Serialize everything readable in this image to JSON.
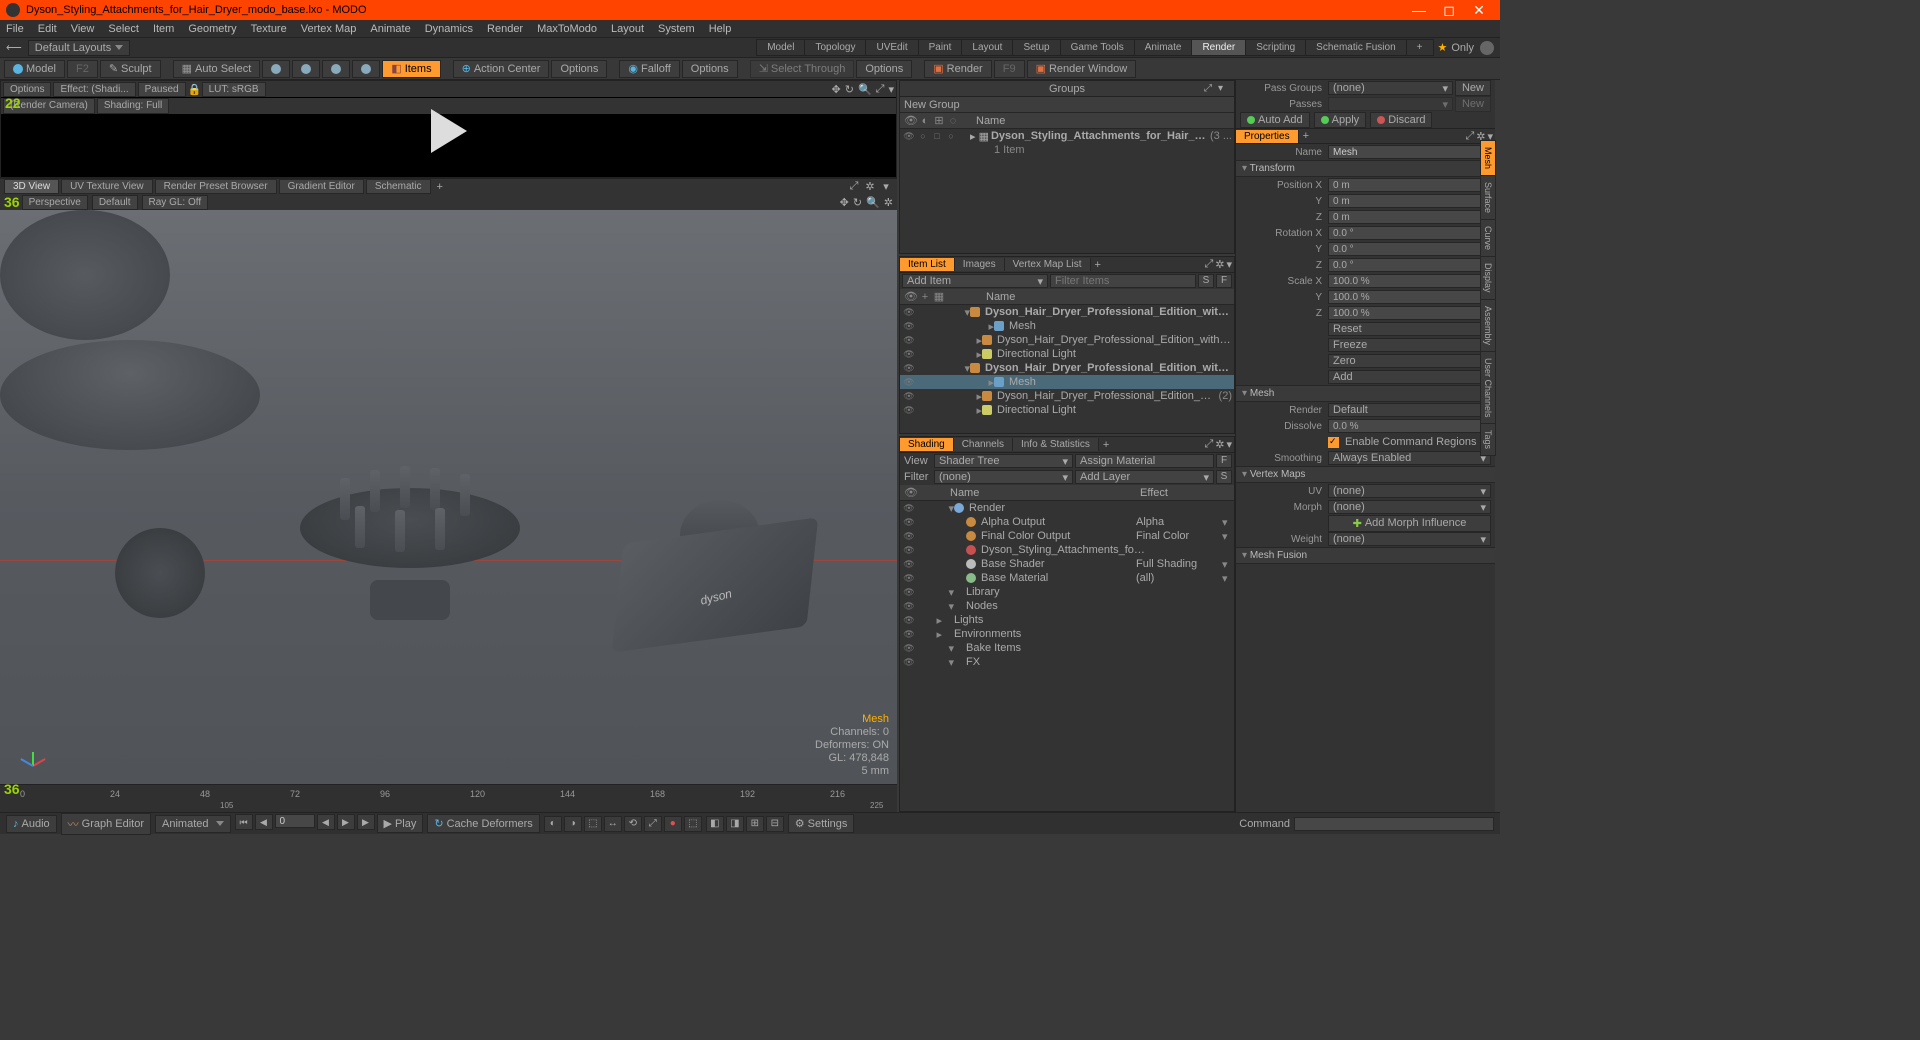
{
  "window": {
    "title": "Dyson_Styling_Attachments_for_Hair_Dryer_modo_base.lxo - MODO"
  },
  "menubar": [
    "File",
    "Edit",
    "View",
    "Select",
    "Item",
    "Geometry",
    "Texture",
    "Vertex Map",
    "Animate",
    "Dynamics",
    "Render",
    "MaxToModo",
    "Layout",
    "System",
    "Help"
  ],
  "layout": {
    "default": "Default Layouts",
    "tabs": [
      "Model",
      "Topology",
      "UVEdit",
      "Paint",
      "Layout",
      "Setup",
      "Game Tools",
      "Animate",
      "Render",
      "Scripting",
      "Schematic Fusion"
    ],
    "active_tab": "Render",
    "only": "Only"
  },
  "toolbar": {
    "model": "Model",
    "sculpt": "Sculpt",
    "autoselect": "Auto Select",
    "items": "Items",
    "actioncenter": "Action Center",
    "options": "Options",
    "falloff": "Falloff",
    "selectthrough": "Select Through",
    "render": "Render",
    "renderwindow": "Render Window"
  },
  "preview": {
    "options": "Options",
    "effect": "Effect: (Shadi...",
    "paused": "Paused",
    "lut": "LUT: sRGB",
    "camera": "(Render Camera)",
    "shading": "Shading: Full",
    "badge": "22"
  },
  "viewtabs": [
    "3D View",
    "UV Texture View",
    "Render Preset Browser",
    "Gradient Editor",
    "Schematic"
  ],
  "viewopts": {
    "persp": "Perspective",
    "default": "Default",
    "raygl": "Ray GL: Off",
    "badge": "36"
  },
  "vpinfo": {
    "mesh": "Mesh",
    "channels": "Channels: 0",
    "deformers": "Deformers: ON",
    "gl": "GL: 478,848",
    "unit": "5 mm"
  },
  "timeline": {
    "badge": "36",
    "ticks": [
      "0",
      "24",
      "48",
      "72",
      "96",
      "120",
      "144",
      "168",
      "192",
      "216"
    ],
    "sub1": "105",
    "sub2": "225"
  },
  "bottombar": {
    "audio": "Audio",
    "graph": "Graph Editor",
    "animated": "Animated",
    "frame": "0",
    "play": "Play",
    "cache": "Cache Deformers",
    "settings": "Settings"
  },
  "groups": {
    "title": "Groups",
    "newgroup": "New Group",
    "name": "Name",
    "item": "Dyson_Styling_Attachments_for_Hair_Dryer",
    "count": "(3 ...",
    "items": "1 Item"
  },
  "passes": {
    "passgroups": "Pass Groups",
    "none": "(none)",
    "new": "New",
    "passes": "Passes",
    "new2": "New",
    "autoadd": "Auto Add",
    "apply": "Apply",
    "discard": "Discard"
  },
  "itemlist": {
    "tabs": [
      "Item List",
      "Images",
      "Vertex Map List"
    ],
    "additem": "Add Item",
    "filter": "Filter Items",
    "name": "Name",
    "rows": [
      {
        "n": "Dyson_Hair_Dryer_Professional_Edition_with_Attachments...",
        "bold": true,
        "ind": 1,
        "ic": "#c88a40"
      },
      {
        "n": "Mesh",
        "ind": 3,
        "ic": "#6aa0c8"
      },
      {
        "n": "Dyson_Hair_Dryer_Professional_Edition_with_Attachme ...",
        "ind": 2,
        "ic": "#c88a40"
      },
      {
        "n": "Directional Light",
        "ind": 2,
        "ic": "#cccc66"
      },
      {
        "n": "Dyson_Hair_Dryer_Professional_Edition_with_Stand_modo...",
        "bold": true,
        "ind": 1,
        "ic": "#c88a40"
      },
      {
        "n": "Mesh",
        "ind": 3,
        "ic": "#6aa0c8",
        "sel": true
      },
      {
        "n": "Dyson_Hair_Dryer_Professional_Edition_with_Stand",
        "ind": 2,
        "ic": "#c88a40",
        "g": "(2)"
      },
      {
        "n": "Directional Light",
        "ind": 2,
        "ic": "#cccc66"
      }
    ]
  },
  "shading": {
    "tabs": [
      "Shading",
      "Channels",
      "Info & Statistics"
    ],
    "view": "View",
    "shadertree": "Shader Tree",
    "assign": "Assign Material",
    "filter": "Filter",
    "none": "(none)",
    "addlayer": "Add Layer",
    "name": "Name",
    "effect": "Effect",
    "rows": [
      {
        "n": "Render",
        "ind": 1,
        "ic": "#7aa8d8",
        "eff": ""
      },
      {
        "n": "Alpha Output",
        "ind": 2,
        "ic": "#c88a40",
        "eff": "Alpha"
      },
      {
        "n": "Final Color Output",
        "ind": 2,
        "ic": "#c88a40",
        "eff": "Final Color"
      },
      {
        "n": "Dyson_Styling_Attachments_for_Hair_...",
        "ind": 2,
        "ic": "#c85050",
        "eff": ""
      },
      {
        "n": "Base Shader",
        "ind": 2,
        "ic": "#bbbbbb",
        "eff": "Full Shading"
      },
      {
        "n": "Base Material",
        "ind": 2,
        "ic": "#88bb88",
        "eff": "(all)"
      },
      {
        "n": "Library",
        "ind": 1,
        "ic": "",
        "eff": ""
      },
      {
        "n": "Nodes",
        "ind": 1,
        "ic": "",
        "eff": ""
      },
      {
        "n": "Lights",
        "ind": 0,
        "ic": "",
        "eff": ""
      },
      {
        "n": "Environments",
        "ind": 0,
        "ic": "",
        "eff": ""
      },
      {
        "n": "Bake Items",
        "ind": 1,
        "ic": "",
        "eff": ""
      },
      {
        "n": "FX",
        "ind": 1,
        "ic": "",
        "eff": ""
      }
    ]
  },
  "props": {
    "title": "Properties",
    "namelbl": "Name",
    "name": "Mesh",
    "transform": "Transform",
    "posx": "Position X",
    "posy": "Y",
    "posz": "Z",
    "pval": "0 m",
    "rotx": "Rotation X",
    "roty": "Y",
    "rotz": "Z",
    "rval": "0.0 °",
    "sclx": "Scale X",
    "scly": "Y",
    "sclz": "Z",
    "sval": "100.0 %",
    "reset": "Reset",
    "freeze": "Freeze",
    "zero": "Zero",
    "add": "Add",
    "mesh": "Mesh",
    "render": "Render",
    "default": "Default",
    "dissolve": "Dissolve",
    "dval": "0.0 %",
    "enable": "Enable Command Regions",
    "smoothing": "Smoothing",
    "always": "Always Enabled",
    "vmaps": "Vertex Maps",
    "uv": "UV",
    "morph": "Morph",
    "none": "(none)",
    "addmorph": "Add Morph Influence",
    "weight": "Weight",
    "fusion": "Mesh Fusion",
    "sidetabs": [
      "Mesh",
      "Surface",
      "Curve",
      "Display",
      "Assembly",
      "User Channels",
      "Tags"
    ]
  },
  "command": "Command"
}
